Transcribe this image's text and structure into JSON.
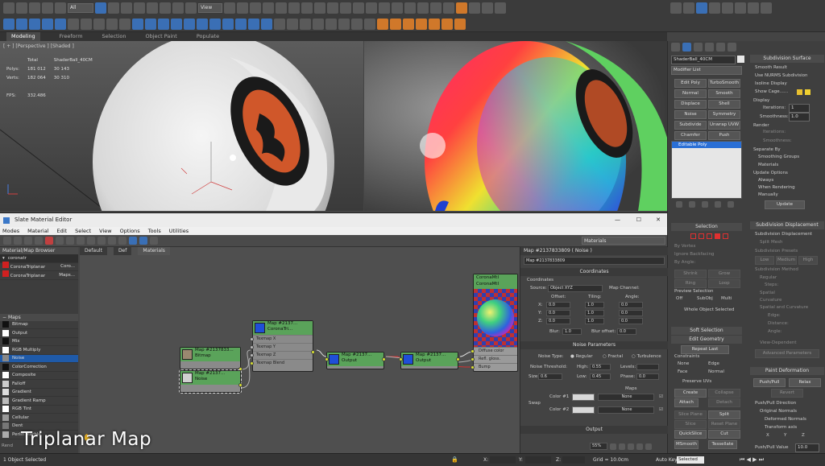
{
  "toolbar": {
    "selection_filter": "All",
    "reference_coord": "View"
  },
  "ribbon_tabs": [
    "Modeling",
    "Freeform",
    "Selection",
    "Object Paint",
    "Populate"
  ],
  "viewport_left": {
    "label": "[ + ] [Perspective ] [Shaded ]",
    "stats": {
      "total_label": "Total",
      "object_label": "ShaderBall_40CM",
      "polys_label": "Polys:",
      "polys_total": "181 012",
      "polys_obj": "30 143",
      "verts_label": "Verts:",
      "verts_total": "182 064",
      "verts_obj": "30 310",
      "fps_label": "FPS:",
      "fps_value": "332.486"
    }
  },
  "command_panel": {
    "object_name": "ShaderBall_40CM",
    "modifier_list": "Modifier List",
    "mod_buttons": [
      "Edit Poly",
      "TurboSmooth",
      "Normal",
      "Smooth",
      "Displace",
      "Shell",
      "Noise",
      "Symmetry",
      "Subdivide",
      "Unwrap UVW",
      "Chamfer",
      "Push"
    ],
    "stack_item": "Editable Poly",
    "selection_head": "Selection",
    "by_vertex": "By Vertex",
    "ignore_backfacing": "Ignore Backfacing",
    "by_angle": "By Angle:",
    "shrink": "Shrink",
    "grow": "Grow",
    "ring": "Ring",
    "loop": "Loop",
    "preview_selection": "Preview Selection",
    "off": "Off",
    "subobj": "SubObj",
    "multi": "Multi",
    "whole_object": "Whole Object Selected",
    "soft_selection": "Soft Selection",
    "edit_geometry": "Edit Geometry",
    "repeat_last": "Repeat Last",
    "constraints": "Constraints",
    "none": "None",
    "edge": "Edge",
    "face": "Face",
    "normal": "Normal",
    "preserve_uvs": "Preserve UVs",
    "create": "Create",
    "collapse": "Collapse",
    "attach": "Attach",
    "detach": "Detach",
    "slice_plane": "Slice Plane",
    "split": "Split",
    "slice": "Slice",
    "reset_plane": "Reset Plane",
    "quickslice": "QuickSlice",
    "cut": "Cut",
    "msmooth": "MSmooth",
    "tessellate": "Tessellate",
    "subdiv_surface": "Subdivision Surface",
    "smooth_result": "Smooth Result",
    "use_nurms": "Use NURMS Subdivision",
    "isoline": "Isoline Display",
    "show_cage": "Show Cage......",
    "display": "Display",
    "iterations_label": "Iterations:",
    "iterations": "1",
    "smoothness_label": "Smoothness:",
    "smoothness": "1.0",
    "render": "Render",
    "r_iterations": "Iterations:",
    "r_smoothness": "Smoothness:",
    "separate_by": "Separate By",
    "smoothing_groups": "Smoothing Groups",
    "materials": "Materials",
    "update_options": "Update Options",
    "always": "Always",
    "when_rendering": "When Rendering",
    "manually": "Manually",
    "update": "Update",
    "subdiv_displacement": "Subdivision Displacement",
    "subdiv_displacement_cb": "Subdivision Displacement",
    "split_mesh": "Split Mesh",
    "subdiv_presets": "Subdivision Presets",
    "low": "Low",
    "medium": "Medium",
    "high": "High",
    "subdiv_method": "Subdivision Method",
    "regular": "Regular",
    "steps": "Steps:",
    "spatial": "Spatial",
    "curvature": "Curvature",
    "spatial_curvature": "Spatial and Curvature",
    "edge_l": "Edge:",
    "distance": "Distance:",
    "angle": "Angle:",
    "view_dependent": "View-Dependent",
    "adv_params": "Advanced Parameters",
    "paint_deformation": "Paint Deformation",
    "push_pull": "Push/Pull",
    "relax": "Relax",
    "revert": "Revert",
    "push_pull_dir": "Push/Pull Direction",
    "original_normals": "Original Normals",
    "deformed_normals": "Deformed Normals",
    "transform_axis": "Transform axis",
    "x": "X",
    "y": "Y",
    "z": "Z",
    "push_pull_value": "Push/Pull Value",
    "push_pull_num": "10.0"
  },
  "sme": {
    "title": "Slate Material Editor",
    "menu": [
      "Modes",
      "Material",
      "Edit",
      "Select",
      "View",
      "Options",
      "Tools",
      "Utilities"
    ],
    "materials_dropdown": "Materials",
    "browser_title": "Material/Map Browser",
    "search": "coronatr",
    "search_results": [
      {
        "name": "CoronaTriplanar",
        "type": "Coro..."
      },
      {
        "name": "CoronaTriplanar",
        "type": "Maps..."
      }
    ],
    "maps_head": "Maps",
    "maps": [
      "Bitmap",
      "Output",
      "Mix",
      "RGB Multiply",
      "Noise",
      "ColorCorrection",
      "Composite",
      "Falloff",
      "Gradient",
      "Gradient Ramp",
      "RGB Tint",
      "Cellular",
      "Dent",
      "Perlin Marble"
    ],
    "view_tabs": [
      "Default",
      "Def",
      "Materials"
    ],
    "nodes": {
      "bitmap": {
        "title": "Map #2137833...",
        "sub": "Bitmap"
      },
      "noise": {
        "title": "Map #2137...",
        "sub": "Noise"
      },
      "triplanar": {
        "title": "Map #2137...",
        "sub": "CoronaTri...",
        "rows": [
          "Texmap X",
          "Texmap Y",
          "Texmap Z",
          "Texmap Blend"
        ]
      },
      "output1": {
        "title": "Map #2137...",
        "sub": "Output"
      },
      "output2": {
        "title": "Map #2137...",
        "sub": "Output"
      },
      "coronamtl": {
        "title": "CoronaMtl",
        "sub": "CoronaMtl",
        "rows": [
          "Diffuse color",
          "Refl. gloss.",
          "Bump"
        ]
      }
    },
    "props": {
      "header": "Map #2137833809  ( Noise )",
      "name": "Map #2137833809",
      "coordinates_head": "Coordinates",
      "coordinates": "Coordinates",
      "source_label": "Source:",
      "source": "Object XYZ",
      "map_channel": "Map Channel:",
      "offset": "Offset:",
      "tiling": "Tiling:",
      "angle": "Angle:",
      "x": "X:",
      "y": "Y:",
      "z": "Z:",
      "offset_vals": [
        "0.0",
        "0.0",
        "0.0"
      ],
      "tiling_vals": [
        "1.0",
        "1.0",
        "1.0"
      ],
      "angle_vals": [
        "0.0",
        "0.0",
        "0.0"
      ],
      "blur_label": "Blur:",
      "blur": "1.0",
      "blur_offset_label": "Blur offset:",
      "blur_offset": "0.0",
      "noise_head": "Noise Parameters",
      "noise_type": "Noise Type:",
      "regular": "Regular",
      "fractal": "Fractal",
      "turbulence": "Turbulence",
      "noise_threshold": "Noise Threshold:",
      "high_label": "High:",
      "high": "0.55",
      "levels": "Levels:",
      "size_label": "Size:",
      "size": "0.6",
      "low_label": "Low:",
      "low": "0.45",
      "phase_label": "Phase:",
      "phase": "0.0",
      "maps_label": "Maps",
      "color1": "Color #1",
      "color2": "Color #2",
      "none1": "None",
      "none2": "None",
      "swap": "Swap",
      "output_head": "Output"
    },
    "zoom": "55%"
  },
  "status": {
    "selected": "1 Object Selected",
    "x": "X:",
    "y": "Y:",
    "z": "Z:",
    "grid": "Grid = 10.0cm",
    "auto_key": "Auto Key",
    "key_mode": "Selected",
    "render_label": "Rend"
  },
  "caption": "Triplanar Map",
  "colors": {
    "node_green": "#5aa35a",
    "port_yellow": "#d8e030",
    "link_red": "#d03030",
    "accent_blue": "#1f6fd6"
  }
}
